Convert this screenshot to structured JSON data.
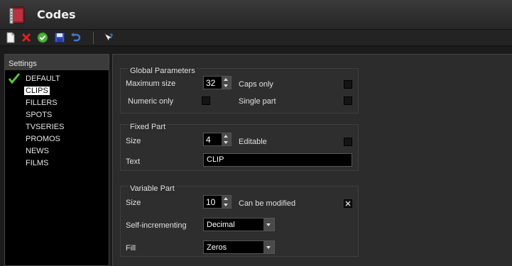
{
  "window": {
    "title": "Codes",
    "icon": "codes-book-icon"
  },
  "toolbar": {
    "buttons": [
      {
        "name": "new",
        "icon": "new-document-icon"
      },
      {
        "name": "delete",
        "icon": "delete-x-icon"
      },
      {
        "name": "apply",
        "icon": "green-check-icon"
      },
      {
        "name": "save",
        "icon": "floppy-disk-icon"
      },
      {
        "name": "undo",
        "icon": "undo-arrow-icon"
      },
      {
        "name": "help",
        "icon": "help-pointer-icon"
      }
    ]
  },
  "settings": {
    "header": "Settings",
    "items": [
      {
        "label": "DEFAULT",
        "checked": true
      },
      {
        "label": "CLIPS",
        "selected": true
      },
      {
        "label": "FILLERS"
      },
      {
        "label": "SPOTS"
      },
      {
        "label": "TVSERIES"
      },
      {
        "label": "PROMOS"
      },
      {
        "label": "NEWS"
      },
      {
        "label": "FILMS"
      }
    ]
  },
  "global": {
    "title": "Global Parameters",
    "max_size_label": "Maximum size",
    "max_size_value": "32",
    "caps_only_label": "Caps only",
    "caps_only_checked": false,
    "numeric_only_label": "Numeric only",
    "numeric_only_checked": false,
    "single_part_label": "Single part",
    "single_part_checked": false
  },
  "fixed": {
    "title": "Fixed Part",
    "size_label": "Size",
    "size_value": "4",
    "editable_label": "Editable",
    "editable_checked": false,
    "text_label": "Text",
    "text_value": "CLIP"
  },
  "variable": {
    "title": "Variable Part",
    "size_label": "Size",
    "size_value": "10",
    "can_modify_label": "Can be modified",
    "can_modify_checked": true,
    "self_inc_label": "Self-incrementing",
    "self_inc_value": "Decimal",
    "fill_label": "Fill",
    "fill_value": "Zeros"
  },
  "colors": {
    "background": "#1b1b1b",
    "panel": "#2c2c2c",
    "selected_bg": "#ffffff",
    "check_green": "#5cc23a"
  }
}
